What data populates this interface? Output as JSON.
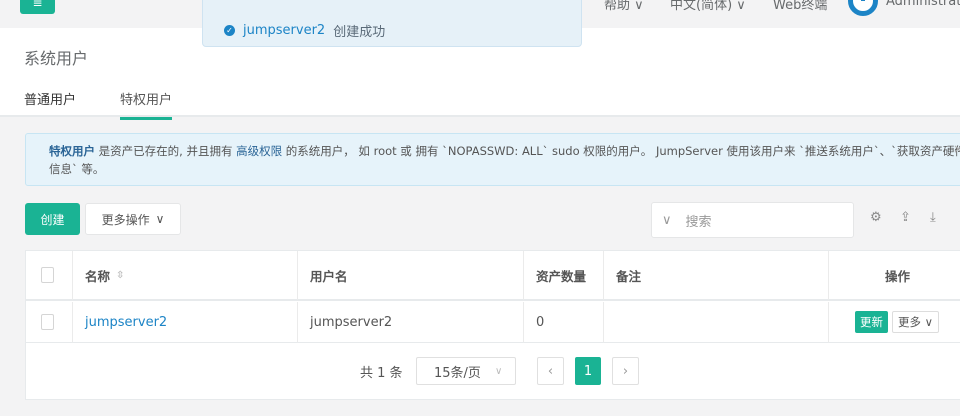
{
  "topbar": {
    "menu_icon": "menu-icon",
    "help": "帮助",
    "language": "中文(简体)",
    "web_terminal": "Web终端",
    "user": "Administrator"
  },
  "toast": {
    "name": "jumpserver2",
    "message": "创建成功"
  },
  "page": {
    "title": "系统用户",
    "tabs": [
      {
        "label": "普通用户"
      },
      {
        "label": "特权用户"
      }
    ]
  },
  "alert": {
    "strong": "特权用户",
    "p1": " 是资产已存在的, 并且拥有 ",
    "hl": "高级权限",
    "p2": " 的系统用户， 如 root 或 拥有 `NOPASSWD: ALL` sudo 权限的用户。 JumpServer 使用该用户来 `推送系统用户`、`获取资产硬件信息` 等。",
    "close": "×"
  },
  "toolbar": {
    "create": "创建",
    "more": "更多操作",
    "search_placeholder": "搜索"
  },
  "table": {
    "headers": [
      "名称",
      "用户名",
      "资产数量",
      "备注",
      "操作"
    ],
    "rows": [
      {
        "name": "jumpserver2",
        "username": "jumpserver2",
        "assets": "0",
        "comment": "",
        "update": "更新",
        "more": "更多"
      }
    ]
  },
  "pagination": {
    "total": "共 1 条",
    "page_size": "15条/页",
    "current": "1"
  },
  "colors": {
    "accent": "#1ab394",
    "link": "#1c84c6"
  }
}
